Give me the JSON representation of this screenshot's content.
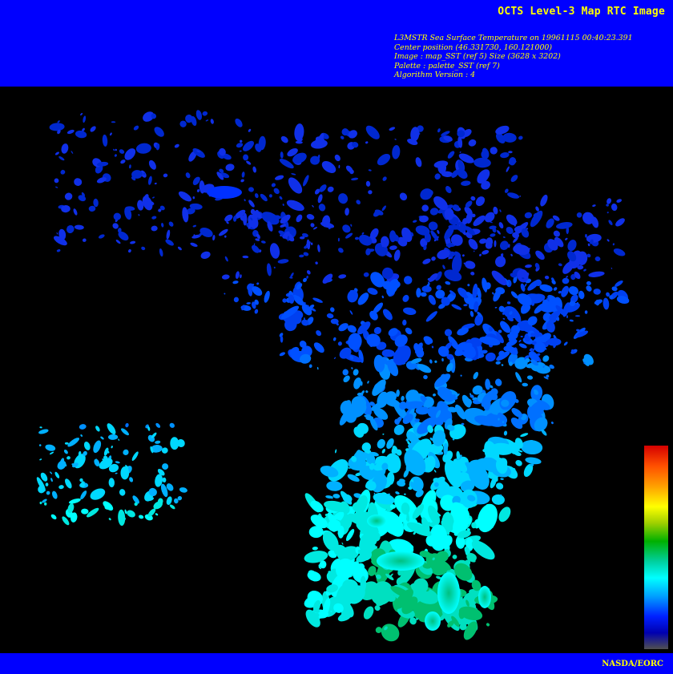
{
  "header": {
    "title": "OCTS Level-3 Map RTC Image",
    "lines": [
      "L3MSTR Sea Surface Temperature on 19961115 00:40:23.391",
      "Center position (46.331730, 160.121000)",
      "Image : map_SST (ref 5) Size (3628 x 3202)",
      "Palette : palette_SST (ref 7)",
      "Algorithm Version : 4"
    ]
  },
  "map": {
    "background_color": "#000000",
    "palette_colors": [
      "#d50000",
      "#ff5000",
      "#ffa000",
      "#ffff00",
      "#a0d000",
      "#00b000",
      "#00d0a0",
      "#00ffff",
      "#00a0ff",
      "#0020ff",
      "#0000b0",
      "#505050"
    ]
  },
  "footer": {
    "credit": "NASDA/EORC"
  },
  "colors": {
    "banner": "#0000ff",
    "text": "#ffff00"
  }
}
